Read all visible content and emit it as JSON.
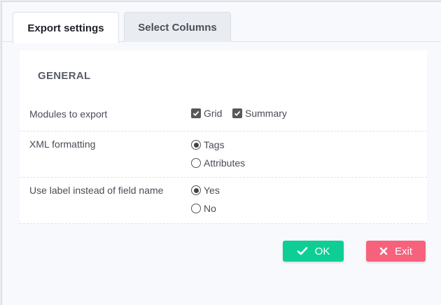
{
  "tabs": [
    {
      "label": "Export settings",
      "active": true
    },
    {
      "label": "Select Columns",
      "active": false
    }
  ],
  "section": {
    "title": "GENERAL"
  },
  "rows": {
    "modules": {
      "label": "Modules to export",
      "options": [
        {
          "label": "Grid",
          "checked": true
        },
        {
          "label": "Summary",
          "checked": true
        }
      ]
    },
    "xml": {
      "label": "XML formatting",
      "options": [
        {
          "label": "Tags",
          "selected": true
        },
        {
          "label": "Attributes",
          "selected": false
        }
      ]
    },
    "uselabel": {
      "label": "Use label instead of field name",
      "options": [
        {
          "label": "Yes",
          "selected": true
        },
        {
          "label": "No",
          "selected": false
        }
      ]
    }
  },
  "buttons": {
    "ok": "OK",
    "exit": "Exit"
  },
  "colors": {
    "ok": "#0fce95",
    "exit": "#f6617c",
    "panel": "#ffffff",
    "background": "#f8f9fc"
  },
  "icons": {
    "ok": "checkmark-icon",
    "exit": "x-icon",
    "checkbox": "checkbox-checked-icon",
    "radio": "radio-icon"
  }
}
